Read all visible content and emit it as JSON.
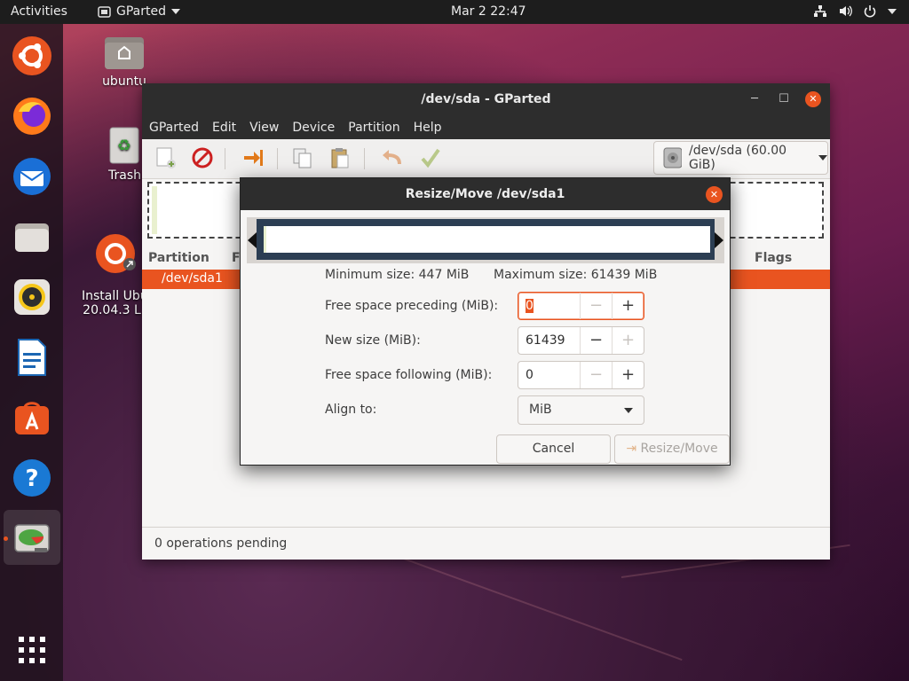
{
  "topbar": {
    "activities": "Activities",
    "app_name": "GParted",
    "clock": "Mar 2  22:47",
    "tray_icons": [
      "network-icon",
      "volume-icon",
      "power-icon"
    ]
  },
  "dock": {
    "items": [
      "ubuntu-software-icon",
      "firefox-icon",
      "thunderbird-icon",
      "files-icon",
      "rhythmbox-icon",
      "libreoffice-writer-icon",
      "app-center-icon",
      "help-icon",
      "gparted-icon",
      "show-apps-icon"
    ]
  },
  "desktop": {
    "icons": [
      {
        "label": "ubuntu"
      },
      {
        "label": "Trash"
      },
      {
        "label": "Install Ubu\n20.04.3 L"
      }
    ]
  },
  "gparted": {
    "title": "/dev/sda - GParted",
    "menu": [
      "GParted",
      "Edit",
      "View",
      "Device",
      "Partition",
      "Help"
    ],
    "device_selector": "/dev/sda (60.00 GiB)",
    "columns": {
      "partition": "Partition",
      "fs_partial": "F",
      "flags": "Flags"
    },
    "selected_row": "/dev/sda1",
    "status": "0 operations pending"
  },
  "dialog": {
    "title": "Resize/Move /dev/sda1",
    "min_size": "Minimum size: 447 MiB",
    "max_size": "Maximum size: 61439 MiB",
    "fields": {
      "preceding_label": "Free space preceding (MiB):",
      "preceding_value": "0",
      "new_size_label": "New size (MiB):",
      "new_size_value": "61439",
      "following_label": "Free space following (MiB):",
      "following_value": "0",
      "align_label": "Align to:",
      "align_value": "MiB"
    },
    "cancel": "Cancel",
    "resize": "Resize/Move"
  },
  "colors": {
    "accent": "#e95420",
    "titlebar": "#2d2d2d",
    "partition_bar": "#2c3e53"
  }
}
